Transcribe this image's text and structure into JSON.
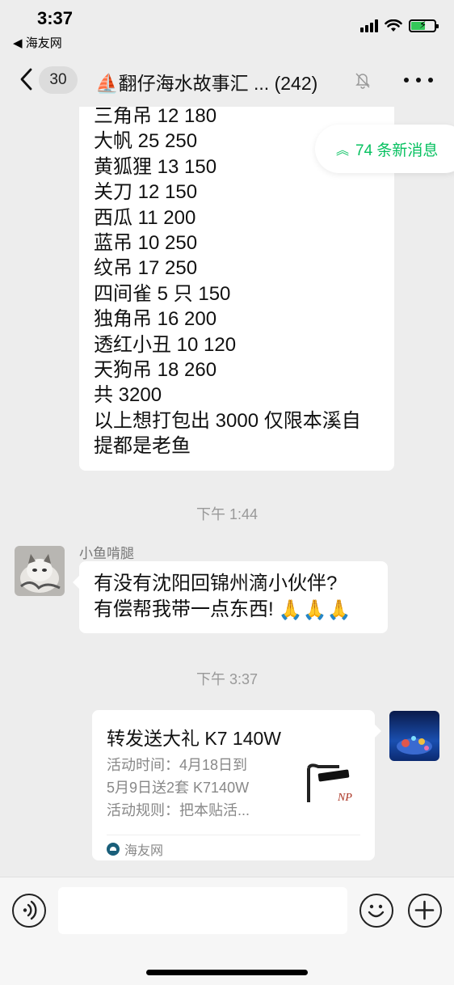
{
  "status_bar": {
    "time": "3:37",
    "back_app": "◀ 海友网"
  },
  "nav": {
    "unread_count": "30",
    "title": "⛵翻仔海水故事汇 ... (242)",
    "icons": [
      "chevron-left-icon",
      "bell-muted-icon",
      "more-icon"
    ]
  },
  "messages": {
    "fish_list": [
      "三角吊 12 180",
      "大帆 25 250",
      "黄狐狸 13 150",
      "关刀 12 150",
      "西瓜 11 200",
      "蓝吊 10 250",
      "纹吊 17 250",
      "四间雀 5 只 150",
      "独角吊 16 200",
      "透红小丑 10 120",
      "天狗吊 18 260",
      "共 3200",
      "以上想打包出 3000 仅限本溪自",
      "提都是老鱼"
    ],
    "new_messages_pill": "74 条新消息",
    "timestamp_1": "下午 1:44",
    "sender_name": "小鱼啃腿",
    "incoming_line_1": "有没有沈阳回锦州滴小伙伴?",
    "incoming_line_2": "有偿帮我带一点东西!",
    "incoming_emoji": "🙏🙏🙏",
    "timestamp_2": "下午 3:37",
    "link_card": {
      "title": "转发送大礼 K7 140W",
      "desc_lines": [
        "活动时间：4月18日到",
        "5月9日送2套 K7140W",
        "活动规则：把本贴活..."
      ],
      "thumb_text": "NP",
      "source": "海友网"
    }
  },
  "input_bar": {
    "placeholder": "",
    "icons": [
      "voice-icon",
      "emoji-icon",
      "plus-icon"
    ]
  },
  "colors": {
    "background": "#ededed",
    "accent_green": "#07c160",
    "bubble": "#ffffff"
  }
}
